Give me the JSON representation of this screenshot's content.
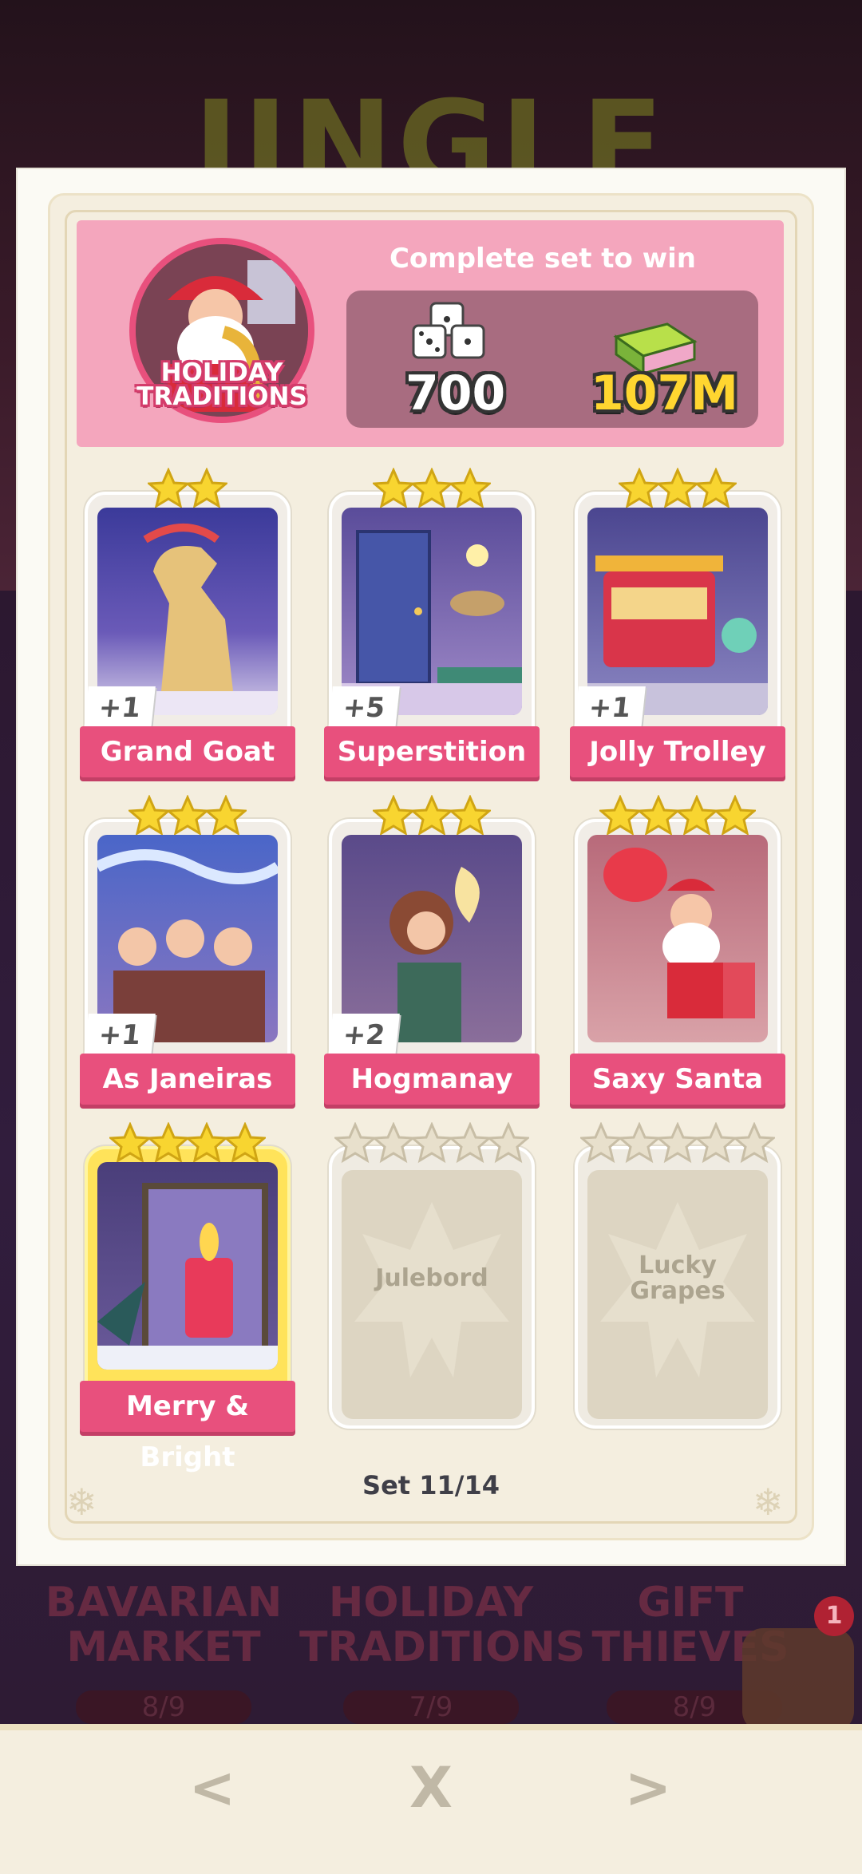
{
  "background": {
    "title": "JINGLE",
    "sets": [
      {
        "label": "BAVARIAN MARKET",
        "count": "8/9"
      },
      {
        "label": "HOLIDAY TRADITIONS",
        "count": "7/9"
      },
      {
        "label": "GIFT THIEVES",
        "count": "8/9"
      }
    ],
    "notification_count": "1"
  },
  "album": {
    "set_name": "HOLIDAY TRADITIONS",
    "complete_text": "Complete set to win",
    "rewards": {
      "dice": "700",
      "cash": "107M"
    },
    "set_progress": "Set 11/14"
  },
  "cards": [
    {
      "name": "Grand Goat",
      "stars": 2,
      "duplicates": "+1",
      "collected": true,
      "gold": false
    },
    {
      "name": "Superstition",
      "stars": 3,
      "duplicates": "+5",
      "collected": true,
      "gold": false
    },
    {
      "name": "Jolly Trolley",
      "stars": 3,
      "duplicates": "+1",
      "collected": true,
      "gold": false
    },
    {
      "name": "As Janeiras",
      "stars": 3,
      "duplicates": "+1",
      "collected": true,
      "gold": false
    },
    {
      "name": "Hogmanay",
      "stars": 3,
      "duplicates": "+2",
      "collected": true,
      "gold": false
    },
    {
      "name": "Saxy Santa",
      "stars": 4,
      "duplicates": "",
      "collected": true,
      "gold": false
    },
    {
      "name": "Merry & Bright",
      "stars": 4,
      "duplicates": "",
      "collected": true,
      "gold": true
    },
    {
      "name": "Julebord",
      "stars": 5,
      "duplicates": "",
      "collected": false,
      "gold": false
    },
    {
      "name": "Lucky Grapes",
      "stars": 5,
      "duplicates": "",
      "collected": false,
      "gold": false
    }
  ],
  "nav": {
    "prev": "<",
    "close": "X",
    "next": ">"
  },
  "colors": {
    "accent": "#e8507d",
    "header_bg": "#f4a6bd",
    "panel_bg": "#f4eedf"
  }
}
